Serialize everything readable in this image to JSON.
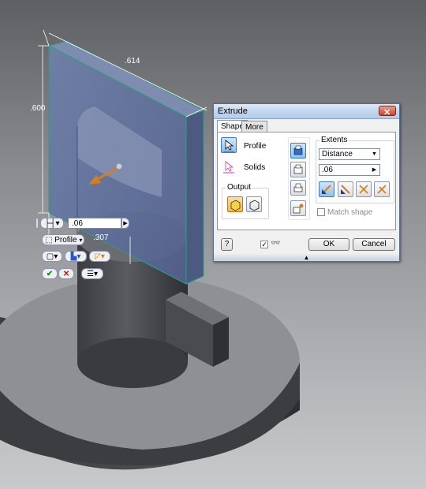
{
  "model": {
    "dimensions": {
      "width": ".614",
      "height": ".600",
      "offset": ".307"
    }
  },
  "minitoolbar": {
    "distance_value": ".06",
    "profile_label": "Profile",
    "icons": [
      "distance-icon",
      "profile-select-icon",
      "output-solid-icon",
      "direction-icon",
      "taper-icon",
      "ok-icon",
      "cancel-icon",
      "menu-icon"
    ]
  },
  "dialog": {
    "title": "Extrude",
    "close_glyph": "✕",
    "tabs": [
      "Shape",
      "More"
    ],
    "active_tab": "Shape",
    "profile_label": "Profile",
    "solids_label": "Solids",
    "output_label": "Output",
    "extents_label": "Extents",
    "extents_type": "Distance",
    "distance_value": ".06",
    "match_shape_label": "Match shape",
    "match_shape_checked": false,
    "preview_checked": true,
    "ok_label": "OK",
    "cancel_label": "Cancel",
    "expand_glyph": "▲",
    "help_glyph": "?"
  },
  "colors": {
    "face": "#5e6f9a",
    "edge": "#2aa07a",
    "arrow": "#d0801c",
    "dialog_title": "#c3d6ee"
  }
}
